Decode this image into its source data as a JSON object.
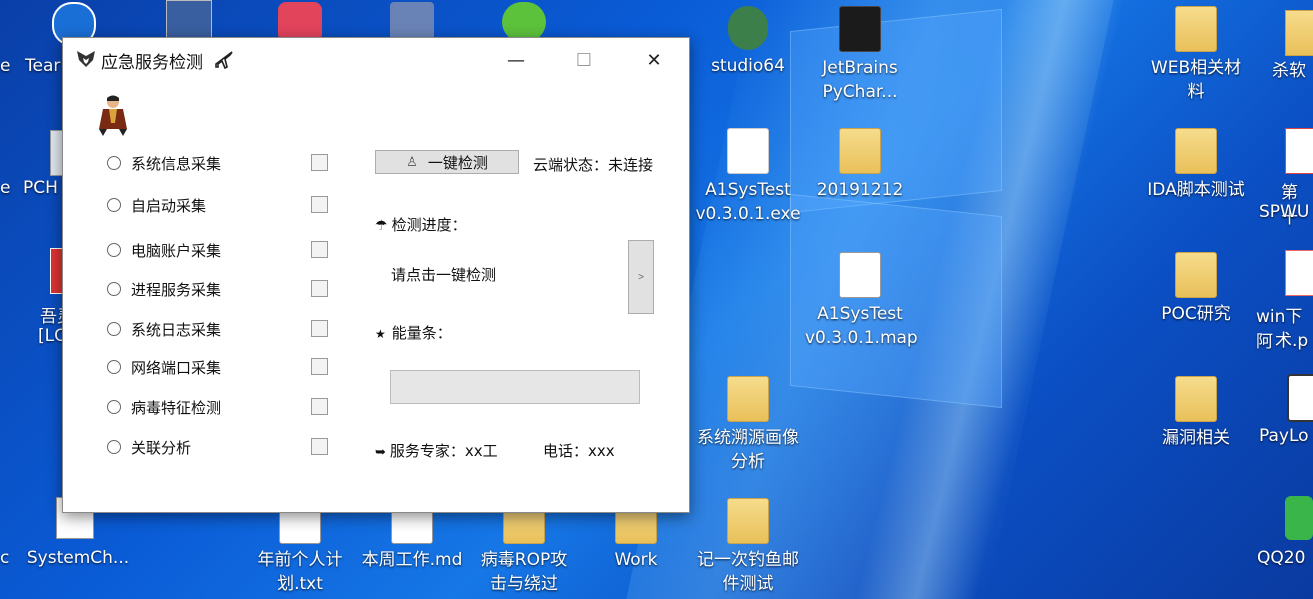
{
  "window": {
    "title": "应急服务检测",
    "minimize": "—",
    "maximize": "☐",
    "close": "✕"
  },
  "items": [
    {
      "label": "系统信息采集"
    },
    {
      "label": "自启动采集"
    },
    {
      "label": "电脑账户采集"
    },
    {
      "label": "进程服务采集"
    },
    {
      "label": "系统日志采集"
    },
    {
      "label": "网络端口采集"
    },
    {
      "label": "病毒特征检测"
    },
    {
      "label": "关联分析"
    }
  ],
  "controls": {
    "onekey_label": "一键检测",
    "cloud_status": "云端状态：未连接",
    "progress_label": "检测进度：",
    "progress_text": "请点击一键检测",
    "arrow_label": ">",
    "energy_label": "能量条：",
    "energy_value": 0,
    "expert": "服务专家：xx工",
    "phone": "电话：xxx"
  },
  "desktop": {
    "icons": [
      {
        "label": "studio64"
      },
      {
        "label": "JetBrains PyChar..."
      },
      {
        "label": "A1SysTest v0.3.0.1.exe"
      },
      {
        "label": "20191212"
      },
      {
        "label": "A1SysTest v0.3.0.1.map"
      },
      {
        "label": "系统溯源画像分析"
      },
      {
        "label": "记一次钓鱼邮件测试"
      },
      {
        "label": "WEB相关材料"
      },
      {
        "label": "IDA脚本测试"
      },
      {
        "label": "POC研究"
      },
      {
        "label": "漏洞相关"
      },
      {
        "label": "年前个人计划.txt"
      },
      {
        "label": "本周工作.md"
      },
      {
        "label": "病毒ROP攻击与绕过"
      },
      {
        "label": "Work"
      },
      {
        "label": "SystemCh..."
      }
    ],
    "partial": [
      {
        "label": "Tear"
      },
      {
        "label": "PCH"
      },
      {
        "label": "吾灵"
      },
      {
        "label": "[LC"
      },
      {
        "label": "杀软"
      },
      {
        "label": "第十"
      },
      {
        "label": "SPWU"
      },
      {
        "label": "win下阿"
      },
      {
        "label": "术.p"
      },
      {
        "label": "PayLo"
      },
      {
        "label": "QQ20"
      },
      {
        "label": "e"
      },
      {
        "label": "e"
      },
      {
        "label": "c"
      }
    ]
  }
}
